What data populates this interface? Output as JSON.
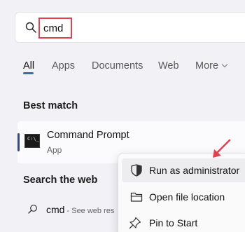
{
  "search": {
    "query": "cmd"
  },
  "tabs": [
    {
      "label": "All",
      "active": true
    },
    {
      "label": "Apps"
    },
    {
      "label": "Documents"
    },
    {
      "label": "Web"
    },
    {
      "label": "More"
    }
  ],
  "best_match": {
    "heading": "Best match",
    "title": "Command Prompt",
    "subtitle": "App"
  },
  "web": {
    "heading": "Search the web",
    "query": "cmd",
    "desc": " - See web res"
  },
  "context_menu": {
    "items": [
      {
        "label": "Run as administrator",
        "icon": "shield-icon"
      },
      {
        "label": "Open file location",
        "icon": "folder-icon"
      },
      {
        "label": "Pin to Start",
        "icon": "pin-icon"
      }
    ]
  },
  "colors": {
    "accent": "#3a6ea5",
    "highlight": "#e0414f",
    "background": "#f2f1f6"
  }
}
